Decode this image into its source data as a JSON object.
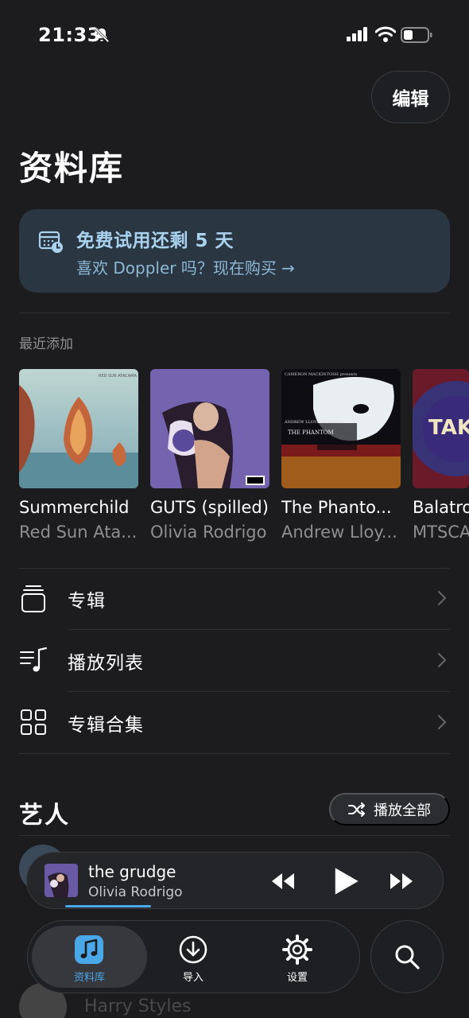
{
  "status_bar": {
    "time": "21:33",
    "icons": [
      "bell-slash-icon",
      "signal-icon",
      "wifi-icon",
      "battery-icon"
    ]
  },
  "header": {
    "edit_label": "编辑",
    "title": "资料库"
  },
  "trial_banner": {
    "icon": "calendar-clock-icon",
    "title": "免费试用还剩 5 天",
    "subtitle": "喜欢 Doppler 吗？现在购买 →"
  },
  "recently_added": {
    "label": "最近添加",
    "albums": [
      {
        "title": "Summerchild",
        "artist": "Red Sun Ata..."
      },
      {
        "title": "GUTS (spilled)",
        "artist": "Olivia Rodrigo"
      },
      {
        "title": "The Phanto...",
        "artist": "Andrew Lloy..."
      },
      {
        "title": "Balatro",
        "artist": "MTSCA"
      }
    ]
  },
  "library_nav": [
    {
      "label": "专辑",
      "icon": "albums-stack-icon"
    },
    {
      "label": "播放列表",
      "icon": "playlist-icon"
    },
    {
      "label": "专辑合集",
      "icon": "grid-icon"
    }
  ],
  "artists": {
    "title": "艺人",
    "play_all_label": "播放全部",
    "play_all_icon": "shuffle-icon",
    "visible_names": [
      "Harry Styles"
    ]
  },
  "now_playing": {
    "title": "the grudge",
    "artist": "Olivia Rodrigo",
    "progress": 0.22,
    "controls": [
      "rewind-icon",
      "play-icon",
      "fast-forward-icon"
    ]
  },
  "tab_bar": {
    "tabs": [
      {
        "label": "资料库",
        "icon": "music-note-icon",
        "active": true
      },
      {
        "label": "导入",
        "icon": "download-icon",
        "active": false
      },
      {
        "label": "设置",
        "icon": "gear-icon",
        "active": false
      }
    ],
    "search_icon": "search-icon"
  },
  "colors": {
    "background": "#1c1c1e",
    "accent": "#4aa8e8",
    "banner_bg": "#2a3641",
    "banner_text": "#a9d2ef"
  }
}
